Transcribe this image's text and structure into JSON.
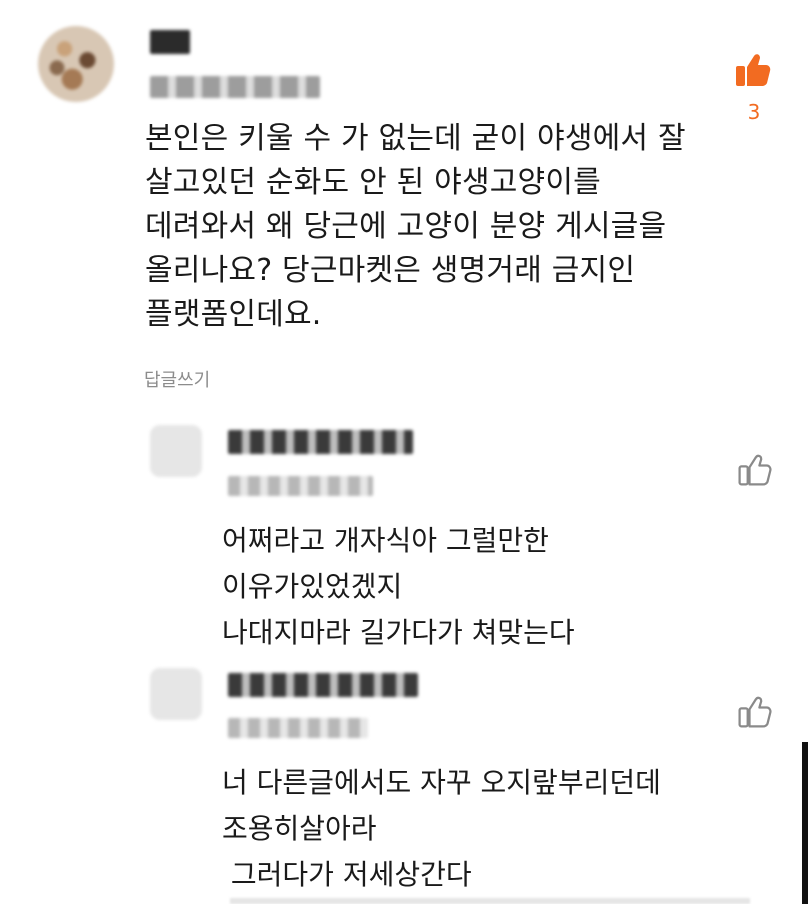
{
  "main_comment": {
    "like_count": "3",
    "text": "본인은 키울 수 가 없는데 굳이 야생에서 잘\n살고있던 순화도 안 된 야생고양이를\n데려와서 왜 당근에 고양이 분양 게시글을\n올리나요? 당근마켓은 생명거래 금지인\n플랫폼인데요.",
    "reply_label": "답글쓰기"
  },
  "replies": [
    {
      "text": "어쩌라고 개자식아 그럴만한\n이유가있었겠지\n나대지마라 길가다가 쳐맞는다"
    },
    {
      "text": "너 다른글에서도 자꾸 오지랖부리던데\n조용히살아라\n 그러다가 저세상간다"
    }
  ],
  "colors": {
    "accent": "#f26b21",
    "muted": "#8c8c8c",
    "text": "#1a1a1a"
  },
  "icons": {
    "like": "thumbs-up-icon"
  }
}
